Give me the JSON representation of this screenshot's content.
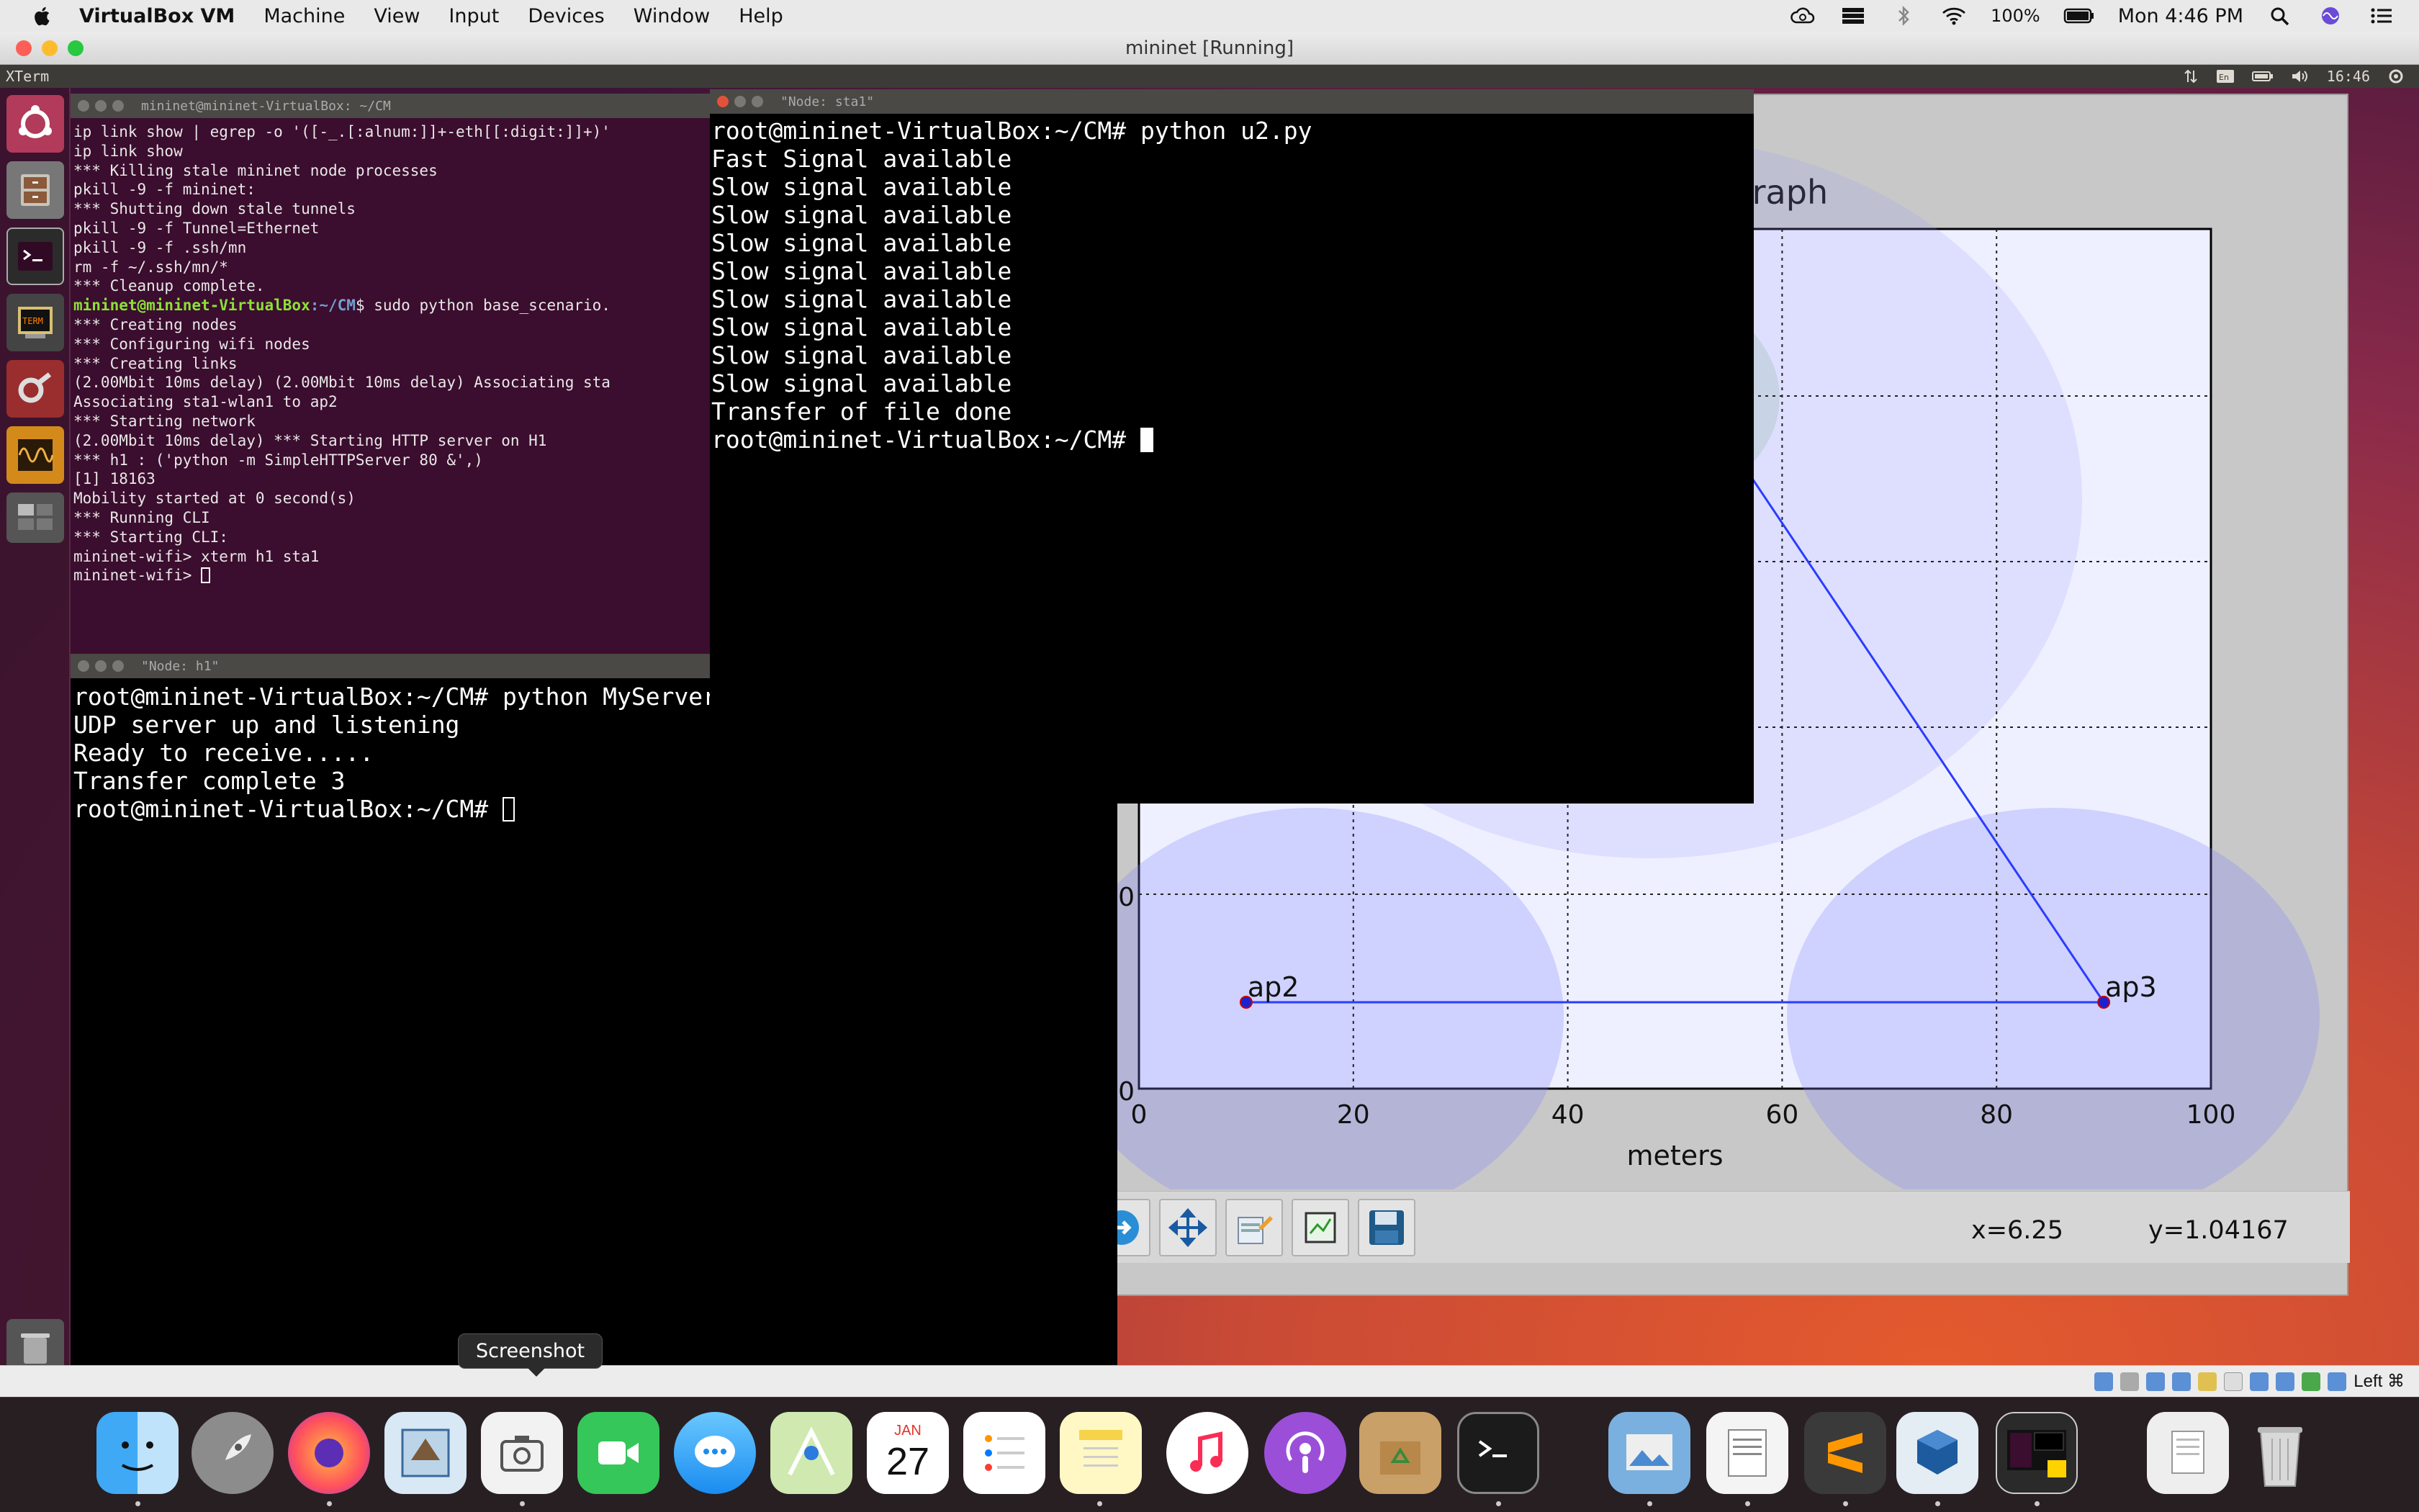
{
  "menubar": {
    "app": "VirtualBox VM",
    "items": [
      "Machine",
      "View",
      "Input",
      "Devices",
      "Window",
      "Help"
    ],
    "battery": "100%",
    "clock": "Mon 4:46 PM"
  },
  "vbox": {
    "title": "mininet [Running]",
    "status_right": "Left ⌘"
  },
  "ubuntu": {
    "panel_title": "XTerm",
    "time": "16:46"
  },
  "windows": {
    "cli": {
      "title": "mininet@mininet-VirtualBox: ~/CM",
      "lines": [
        "ip link show | egrep -o '([-_.[:alnum:]]+-eth[[:digit:]]+)'",
        "ip link show",
        "*** Killing stale mininet node processes",
        "pkill -9 -f mininet:",
        "*** Shutting down stale tunnels",
        "pkill -9 -f Tunnel=Ethernet",
        "pkill -9 -f .ssh/mn",
        "rm -f ~/.ssh/mn/*",
        "*** Cleanup complete."
      ],
      "prompt_user": "mininet@mininet-VirtualBox",
      "prompt_path": ":~/CM",
      "prompt_cmd": "$ sudo python base_scenario.",
      "lines2": [
        "*** Creating nodes",
        "*** Configuring wifi nodes",
        "*** Creating links",
        "(2.00Mbit 10ms delay) (2.00Mbit 10ms delay) Associating sta",
        "Associating sta1-wlan1 to ap2",
        "*** Starting network",
        "(2.00Mbit 10ms delay) *** Starting HTTP server on H1",
        "*** h1 : ('python -m SimpleHTTPServer 80 &',)",
        "[1] 18163",
        "Mobility started at 0 second(s)",
        "*** Running CLI",
        "*** Starting CLI:",
        "mininet-wifi> xterm h1 sta1"
      ],
      "final_prompt": "mininet-wifi> "
    },
    "h1": {
      "title": "\"Node: h1\"",
      "lines": [
        "root@mininet-VirtualBox:~/CM# python MyServer.py",
        "UDP server up and listening",
        "Ready to receive.....",
        "Transfer complete 3"
      ],
      "prompt": "root@mininet-VirtualBox:~/CM# "
    },
    "sta1": {
      "title": "\"Node: sta1\"",
      "lines": [
        "root@mininet-VirtualBox:~/CM# python u2.py",
        "Fast Signal available",
        "Slow signal available",
        "Slow signal available",
        "Slow signal available",
        "Slow signal available",
        "Slow signal available",
        "Slow signal available",
        "Slow signal available",
        "Slow signal available",
        "Transfer of file done"
      ],
      "prompt": "root@mininet-VirtualBox:~/CM# "
    },
    "graph": {
      "title_fragment": "Graph",
      "coord_x": "x=6.25",
      "coord_y": "y=1.04167"
    }
  },
  "chart_data": {
    "type": "scatter",
    "title": "Graph",
    "xlabel": "meters",
    "xlim": [
      0,
      100
    ],
    "x_ticks": [
      "0",
      "20",
      "40",
      "60",
      "80",
      "100"
    ],
    "y_tick_partial": [
      "0",
      "0"
    ],
    "grid": true,
    "nodes": [
      {
        "name": "ap2",
        "x": 10,
        "y": 8
      },
      {
        "name": "ap3",
        "x": 90,
        "y": 8
      }
    ],
    "links": [
      [
        "ap2",
        "ap3"
      ]
    ]
  },
  "dock": {
    "tooltip": "Screenshot",
    "calendar_month": "JAN",
    "calendar_day": "27"
  }
}
